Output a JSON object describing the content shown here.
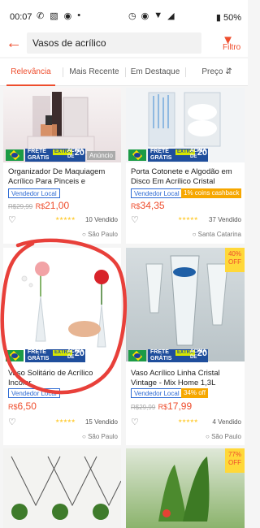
{
  "status": {
    "time": "00:07",
    "battery": "50%",
    "left_icons": [
      "whatsapp-icon",
      "sim-icon",
      "camera-icon",
      "notification-icon"
    ],
    "right_icons": [
      "alarm-icon",
      "location-icon",
      "wifi-icon",
      "signal-icon"
    ]
  },
  "search": {
    "query": "Vasos de acrílico",
    "filter_label": "Filtro"
  },
  "tabs": [
    "Relevância",
    "Mais Recente",
    "Em Destaque",
    "Preço"
  ],
  "badges": {
    "frete_line1": "FRETE",
    "frete_line2": "GRÁTIS",
    "extra": "EXTRA",
    "acima": "ACIMA DE",
    "n20": "20",
    "anuncio": "Anúncio"
  },
  "products": [
    {
      "title": "Organizador De Maquiagem Acrílico Para Pinceis e Cosméti...",
      "badge": "Vendedor Local",
      "cashback": "",
      "old_price": "R$29,99",
      "currency": "R$",
      "price": "21,00",
      "sold": "10 Vendido",
      "location": "São Paulo",
      "discount": "",
      "ad": true
    },
    {
      "title": "Porta Cotonete e Algodão em Disco Em Acrílico Cristal",
      "badge": "Vendedor Local",
      "cashback": "1% coins cashback",
      "old_price": "",
      "currency": "R$",
      "price": "34,35",
      "sold": "37 Vendido",
      "location": "Santa Catarina",
      "discount": "",
      "ad": false
    },
    {
      "title": "Vaso Solitário de Acrílico Incolor",
      "badge": "Vendedor Local",
      "cashback": "",
      "old_price": "",
      "currency": "R$",
      "price": "6,50",
      "sold": "15 Vendido",
      "location": "São Paulo",
      "discount": "",
      "ad": false
    },
    {
      "title": "Vaso Acrílico Linha Cristal Vintage - Mix Home 1,3L **Pro...",
      "badge": "Vendedor Local",
      "cashback": "34% off",
      "old_price": "R$29,99",
      "currency": "R$",
      "price": "17,99",
      "sold": "4 Vendido",
      "location": "São Paulo",
      "discount": "40% OFF",
      "ad": false
    },
    {
      "discount": "77% OFF"
    }
  ],
  "colors": {
    "accent": "#ee4d2d",
    "blue": "#1f4e9c",
    "annotation": "#e8403a"
  }
}
